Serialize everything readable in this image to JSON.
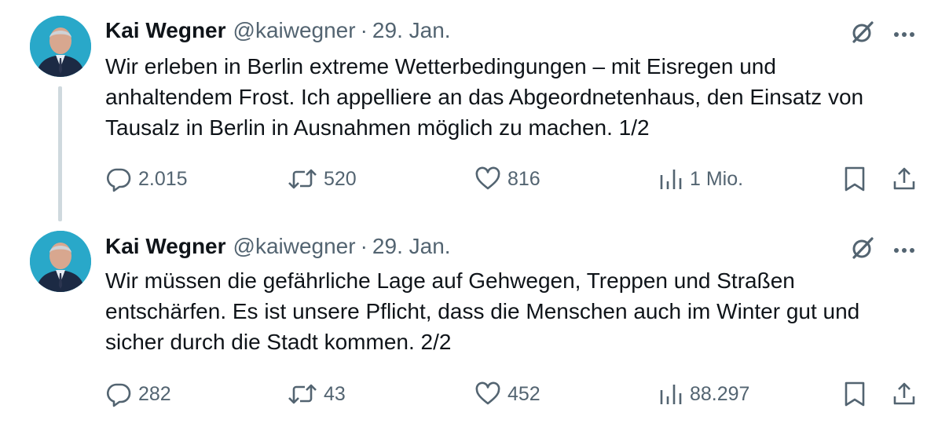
{
  "tweets": [
    {
      "author_name": "Kai Wegner",
      "handle": "@kaiwegner",
      "separator": "·",
      "date": "29. Jan.",
      "text": "Wir erleben in Berlin extreme Wetterbedingungen – mit Eisregen und anhaltendem Frost. Ich appelliere an das Abgeordnetenhaus, den Einsatz von Tausalz in Berlin in Ausnahmen möglich zu machen. 1/2",
      "replies": "2.015",
      "reposts": "520",
      "likes": "816",
      "views": "1 Mio."
    },
    {
      "author_name": "Kai Wegner",
      "handle": "@kaiwegner",
      "separator": "·",
      "date": "29. Jan.",
      "text": "Wir müssen die gefährliche Lage auf Gehwegen, Treppen und Straßen entschärfen. Es ist unsere Pflicht, dass die Menschen auch im Winter gut und sicher durch die Stadt kommen. 2/2",
      "replies": "282",
      "reposts": "43",
      "likes": "452",
      "views": "88.297"
    }
  ],
  "icons": {
    "reply": "speech-bubble-icon",
    "repost": "repost-arrows-icon",
    "like": "heart-icon",
    "views": "bar-chart-icon",
    "bookmark": "bookmark-icon",
    "share": "share-upload-icon",
    "grok": "grok-slash-circle-icon",
    "more": "more-dots-icon"
  },
  "colors": {
    "text": "#0f1419",
    "secondary": "#536471",
    "thread_line": "#cfd9de",
    "avatar_bg": "#29a8c9"
  }
}
